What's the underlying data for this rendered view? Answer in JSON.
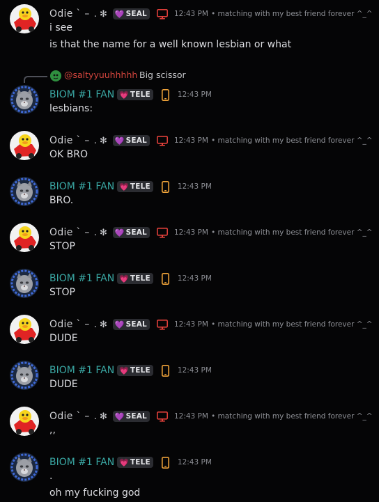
{
  "users": {
    "odie": {
      "name": "Odie ` –",
      "deco": ". ✻",
      "tag_heart": "💜",
      "tag": "SEAL",
      "device": "desktop-icon",
      "status": "• matching with my best friend forever ^_^",
      "avatar": "duck-avatar"
    },
    "biom": {
      "name": "BIOM #1 FAN",
      "tag_heart": "💗",
      "tag": "TELE",
      "device": "mobile-icon",
      "avatar": "cat-avatar"
    }
  },
  "reply": {
    "user": "@saltyyuuhhhhh",
    "text": "Big scissor"
  },
  "messages": [
    {
      "user": "odie",
      "time": "12:43 PM",
      "lines": [
        "i see",
        "is that the name for a well known lesbian or what"
      ]
    },
    {
      "user": "biom",
      "time": "12:43 PM",
      "lines": [
        "lesbians:"
      ]
    },
    {
      "user": "odie",
      "time": "12:43 PM",
      "lines": [
        "OK BRO"
      ]
    },
    {
      "user": "biom",
      "time": "12:43 PM",
      "lines": [
        "BRO."
      ]
    },
    {
      "user": "odie",
      "time": "12:43 PM",
      "lines": [
        "STOP"
      ]
    },
    {
      "user": "biom",
      "time": "12:43 PM",
      "lines": [
        "STOP"
      ]
    },
    {
      "user": "odie",
      "time": "12:43 PM",
      "lines": [
        "DUDE"
      ]
    },
    {
      "user": "biom",
      "time": "12:43 PM",
      "lines": [
        "DUDE"
      ]
    },
    {
      "user": "odie",
      "time": "12:43 PM",
      "lines": [
        ",,"
      ]
    },
    {
      "user": "biom",
      "time": "12:43 PM",
      "lines": [
        ".",
        "oh my fucking god"
      ]
    }
  ]
}
